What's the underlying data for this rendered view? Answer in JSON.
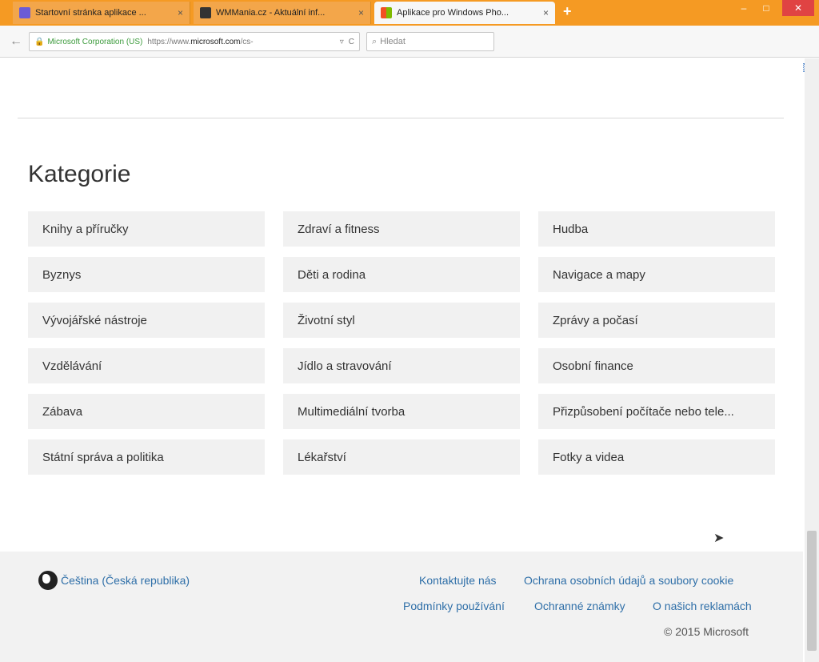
{
  "browser": {
    "tabs": [
      {
        "label": "Startovní stránka aplikace ...",
        "close": "×",
        "active": false
      },
      {
        "label": "WMMania.cz - Aktuální inf...",
        "close": "×",
        "active": false
      },
      {
        "label": "Aplikace pro Windows Pho...",
        "close": "×",
        "active": true
      }
    ],
    "new_tab": "+",
    "window_controls": {
      "minimize": "–",
      "maximize": "□",
      "close": "✕"
    },
    "back": "←",
    "identity": "Microsoft Corporation (US)",
    "url_prefix": "https://www.",
    "url_domain": "microsoft.com",
    "url_suffix": "/cs-",
    "url_dropdown": "▿",
    "reload": "C",
    "search_icon": "🔍",
    "search_placeholder": "Hledat",
    "toolbar_icons": [
      "star-icon",
      "reading-list-icon",
      "download-icon",
      "home-icon",
      "adblock-icon",
      "addon-icon",
      "qr-icon",
      "flag-icon",
      "menu-icon",
      "image-icon"
    ]
  },
  "main": {
    "section_title": "Kategorie",
    "categories": [
      "Knihy a příručky",
      "Zdraví a fitness",
      "Hudba",
      "Byznys",
      "Děti a rodina",
      "Navigace a mapy",
      "Vývojářské nástroje",
      "Životní styl",
      "Zprávy a počasí",
      "Vzdělávání",
      "Jídlo a stravování",
      "Osobní finance",
      "Zábava",
      "Multimediální tvorba",
      "Přizpůsobení počítače nebo tele...",
      "Státní správa a politika",
      "Lékařství",
      "Fotky a videa"
    ]
  },
  "footer": {
    "language": "Čeština (Česká republika)",
    "contact": "Kontaktujte nás",
    "privacy": "Ochrana osobních údajů a soubory cookie",
    "terms": "Podmínky používání",
    "trademarks": "Ochranné známky",
    "ads": "O našich reklamách",
    "copyright": "© 2015 Microsoft"
  },
  "colors": {
    "titlebar": "#f59a23",
    "link": "#2f6fa8",
    "tile": "#f1f1f1"
  }
}
